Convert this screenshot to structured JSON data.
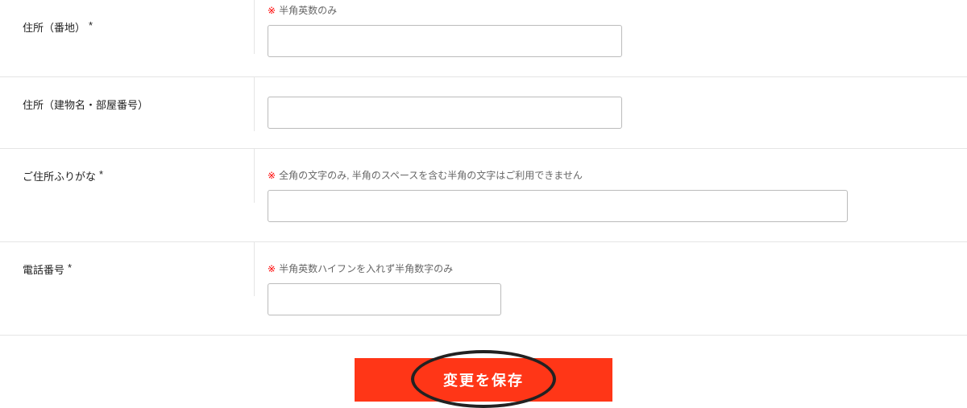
{
  "form": {
    "rows": {
      "street": {
        "label": "住所（番地）",
        "required": "*",
        "hint": "半角英数のみ",
        "hint_mark": "※"
      },
      "building": {
        "label": "住所（建物名・部屋番号）"
      },
      "furigana": {
        "label": "ご住所ふりがな",
        "required": "*",
        "hint": "全角の文字のみ, 半角のスペースを含む半角の文字はご利用できません",
        "hint_mark": "※"
      },
      "phone": {
        "label": "電話番号",
        "required": "*",
        "hint": "半角英数ハイフンを入れず半角数字のみ",
        "hint_mark": "※"
      }
    },
    "submit_label": "変更を保存"
  }
}
